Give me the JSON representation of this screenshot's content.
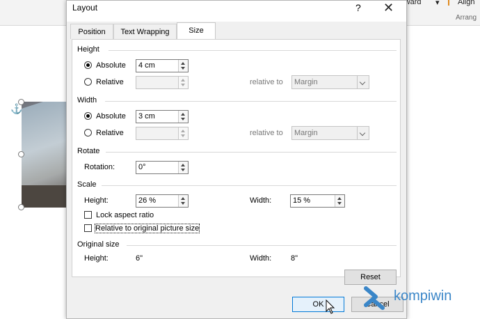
{
  "background": {
    "ribbon_right_text": "rward",
    "ribbon_dropdown": "▾",
    "ribbon_align": "Align",
    "ribbon_group": "Arrang"
  },
  "dialog": {
    "title": "Layout",
    "help_symbol": "?",
    "close_symbol": "✕",
    "tabs": [
      {
        "label": "Position"
      },
      {
        "label": "Text Wrapping"
      },
      {
        "label": "Size"
      }
    ],
    "active_tab": "Size",
    "height": {
      "group_label": "Height",
      "absolute_label": "Absolute",
      "absolute_value": "4 cm",
      "absolute_selected": true,
      "relative_label": "Relative",
      "relative_value": "",
      "relative_to_label": "relative to",
      "relative_to_value": "Margin"
    },
    "width": {
      "group_label": "Width",
      "absolute_label": "Absolute",
      "absolute_value": "3 cm",
      "absolute_selected": true,
      "relative_label": "Relative",
      "relative_value": "",
      "relative_to_label": "relative to",
      "relative_to_value": "Margin"
    },
    "rotate": {
      "group_label": "Rotate",
      "rotation_label": "Rotation:",
      "rotation_value": "0°"
    },
    "scale": {
      "group_label": "Scale",
      "height_label": "Height:",
      "height_value": "26 %",
      "width_label": "Width:",
      "width_value": "15 %",
      "lock_aspect_label": "Lock aspect ratio",
      "lock_aspect_checked": false,
      "relative_original_label": "Relative to original picture size",
      "relative_original_checked": false
    },
    "original_size": {
      "group_label": "Original size",
      "height_label": "Height:",
      "height_value": "6\"",
      "width_label": "Width:",
      "width_value": "8\""
    },
    "reset_label": "Reset",
    "ok_label": "OK",
    "cancel_label": "Cancel"
  },
  "watermark": {
    "text": "kompiwin",
    "color": "#3a86c8"
  },
  "colors": {
    "dialog_bg": "#f0f0f0",
    "panel_bg": "#ffffff",
    "default_button_border": "#0078d7"
  }
}
